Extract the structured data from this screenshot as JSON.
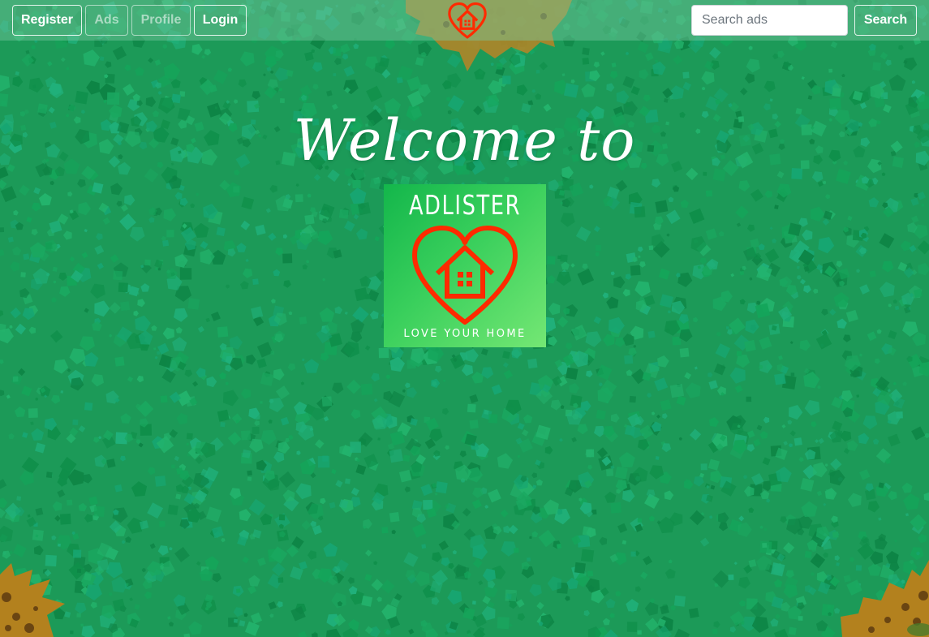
{
  "navbar": {
    "register_label": "Register",
    "ads_label": "Ads",
    "profile_label": "Profile",
    "login_label": "Login",
    "search_placeholder": "Search ads",
    "search_value": "",
    "search_button_label": "Search"
  },
  "hero": {
    "welcome_text": "Welcome to"
  },
  "logo": {
    "brand_name": "ADLISTER",
    "tagline": "LOVE YOUR HOME",
    "icon": "heart-house-icon"
  },
  "colors": {
    "background": "#1c9a58",
    "navbar_overlay": "#78c8a0",
    "logo_gradient_start": "#13b64b",
    "logo_gradient_end": "#74e774",
    "logo_icon": "#ff2a00",
    "text": "#ffffff"
  }
}
